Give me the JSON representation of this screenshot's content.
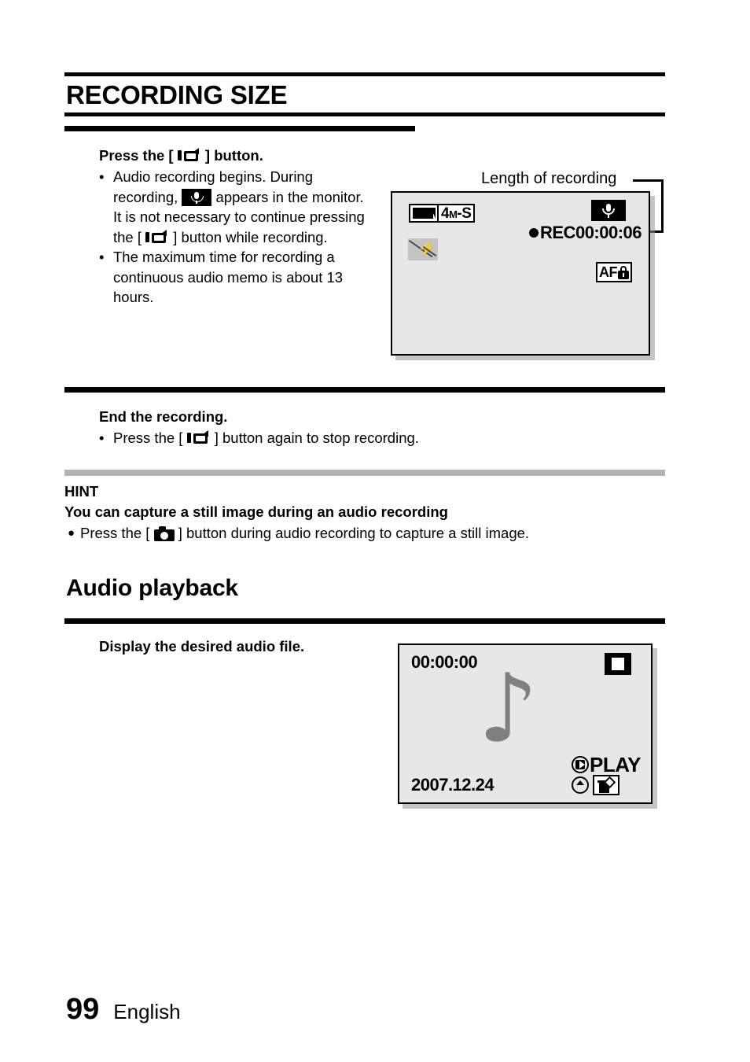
{
  "page": {
    "title": "RECORDING SIZE",
    "number": "99",
    "language": "English"
  },
  "steps": [
    {
      "heading_before": "Press the [",
      "heading_icon": "camcorder-icon",
      "heading_after": "] button.",
      "bullets": [
        {
          "mark": "•",
          "part1": "Audio recording begins. During recording, ",
          "icon1": "microphone-chip-icon",
          "part2": " appears in the monitor. It is not necessary to continue pressing the [ ",
          "icon2": "camcorder-icon",
          "part3": " ] button while recording."
        },
        {
          "mark": "•",
          "part1": "The maximum time for recording a continuous audio memo is about 13 hours."
        }
      ]
    },
    {
      "heading": "End the recording.",
      "bullets": [
        {
          "mark": "•",
          "part1": "Press the [ ",
          "icon1": "camcorder-icon",
          "part2": " ] button again to stop recording."
        }
      ]
    }
  ],
  "hint": {
    "label": "HINT",
    "title": "You can capture a still image during an audio recording",
    "bullet_mark": "●",
    "bullet_part1": "Press the [ ",
    "bullet_icon": "still-camera-icon",
    "bullet_part2": " ] button during audio recording to capture a still image."
  },
  "audio_playback": {
    "heading": "Audio playback",
    "step_heading": "Display the desired audio file."
  },
  "rec_screen": {
    "callout_label": "Length of recording",
    "battery_icon": "battery-full-icon",
    "resolution_main": "4",
    "resolution_sub": "M",
    "resolution_tail": "-S",
    "flash_icon": "flash-off-icon",
    "mic_icon": "microphone-icon",
    "rec_label": "REC",
    "rec_time": "00:00:06",
    "af_label": "AF",
    "af_lock_icon": "lock-icon"
  },
  "play_screen": {
    "time": "00:00:00",
    "date": "2007.12.24",
    "stop_icon": "stop-icon",
    "note_icon": "music-note-icon",
    "play_label": "PLAY",
    "play_pad_icon": "dpad-right-icon",
    "up_button_icon": "up-arrow-button-icon",
    "delete_icon": "trash-delete-icon"
  },
  "colors": {
    "lcd_background": "#e7e7e7",
    "gray_rule": "#b3b3b3",
    "note_gray": "#808080",
    "flash_gray": "#c4c4c4"
  }
}
